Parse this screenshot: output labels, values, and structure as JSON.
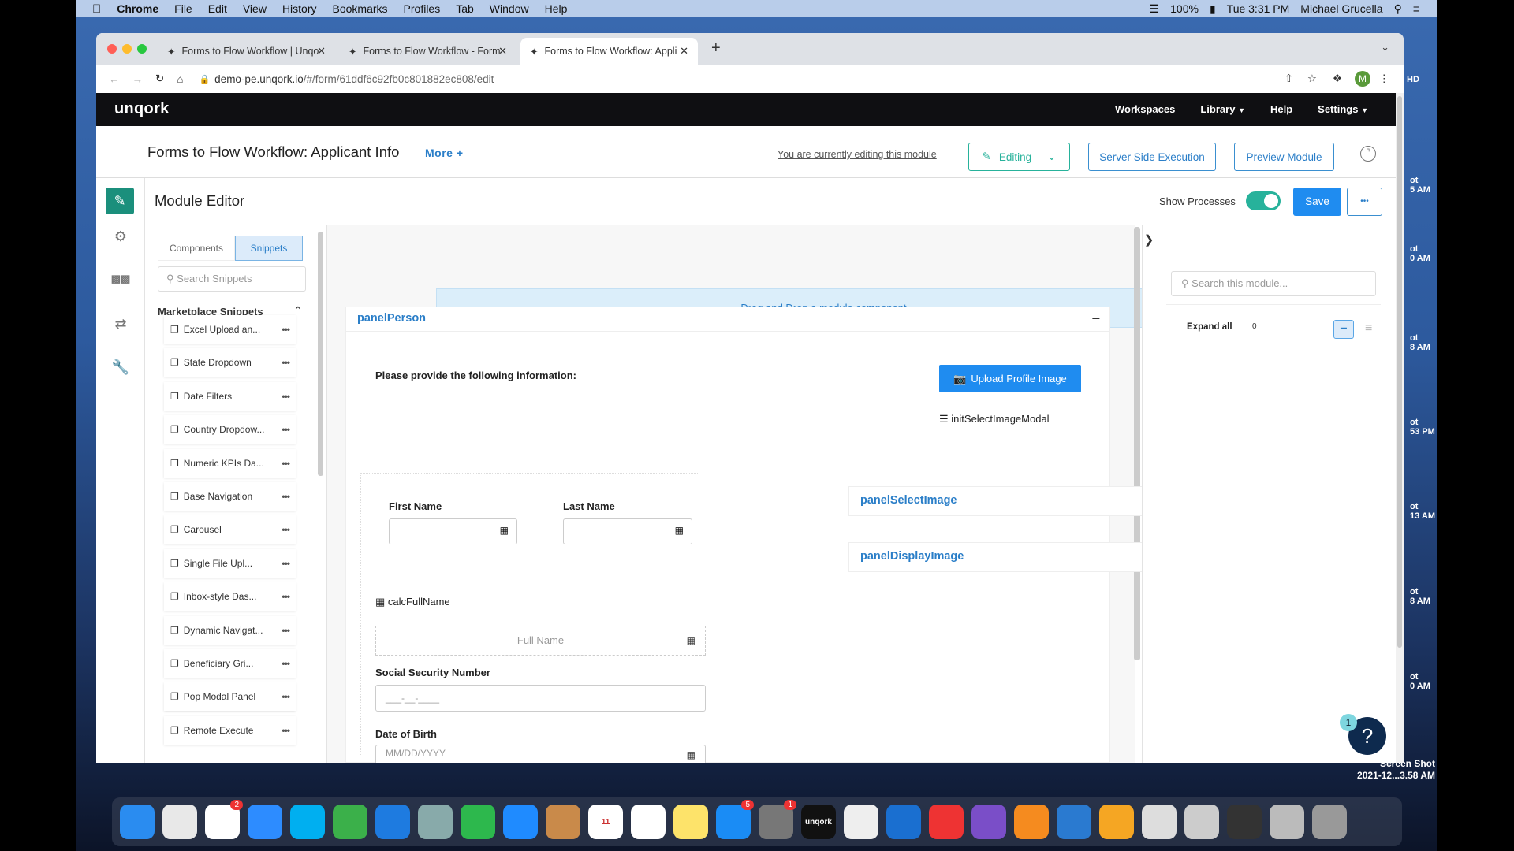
{
  "menubar": {
    "app": "Chrome",
    "items": [
      "File",
      "Edit",
      "View",
      "History",
      "Bookmarks",
      "Profiles",
      "Tab",
      "Window",
      "Help"
    ],
    "battery": "100%",
    "clock": "Tue 3:31 PM",
    "user": "Michael Grucella"
  },
  "browser": {
    "tabs": [
      {
        "label": "Forms to Flow Workflow | Unqo"
      },
      {
        "label": "Forms to Flow Workflow - Form"
      },
      {
        "label": "Forms to Flow Workflow: Appli"
      }
    ],
    "url_host": "demo-pe.unqork.io",
    "url_path": "/#/form/61ddf6c92fb0c801882ec808/edit",
    "profile_initial": "M"
  },
  "app": {
    "logo": "unqork",
    "nav": [
      "Workspaces",
      "Library",
      "Help",
      "Settings"
    ]
  },
  "titlebar": {
    "title": "Forms to Flow Workflow: Applicant Info",
    "more": "More +",
    "editing_notice": "You are currently editing this module",
    "editing": "Editing",
    "server_side": "Server Side Execution",
    "preview": "Preview Module"
  },
  "editor": {
    "title": "Module Editor",
    "show_processes": "Show Processes",
    "show_processes_on": true,
    "save": "Save",
    "more": "•••"
  },
  "snippets": {
    "tabs": [
      "Components",
      "Snippets"
    ],
    "active_tab": "Snippets",
    "search_placeholder": "Search Snippets",
    "section": "Marketplace Snippets",
    "items": [
      "Excel Upload an...",
      "State Dropdown",
      "Date Filters",
      "Country Dropdow...",
      "Numeric KPIs Da...",
      "Base Navigation",
      "Carousel",
      "Single File Upl...",
      "Inbox-style Das...",
      "Dynamic Navigat...",
      "Beneficiary Gri...",
      "Pop Modal Panel",
      "Remote Execute"
    ]
  },
  "canvas": {
    "dropzone": "Drag and Drop a module component",
    "panel": "panelPerson",
    "intro": "Please provide the following information:",
    "upload": "Upload Profile Image",
    "init_modal": "initSelectImageModal",
    "first_name": "First Name",
    "last_name": "Last Name",
    "panel_select": "panelSelectImage",
    "panel_display": "panelDisplayImage",
    "calc": "calcFullName",
    "full_name_placeholder": "Full Name",
    "ssn": "Social Security Number",
    "ssn_mask": "___-__-____",
    "dob": "Date of Birth",
    "dob_placeholder": "MM/DD/YYYY"
  },
  "rightpanel": {
    "search_placeholder": "Search this module...",
    "expand_all": "Expand all",
    "count": "0"
  },
  "help": {
    "badge": "1",
    "label": "?"
  },
  "desktop": {
    "labels": [
      "HD",
      "ot\n5 AM",
      "ot\n0 AM",
      "ot\n8 AM",
      "ot\n53 PM",
      "ot\n13 AM",
      "ot\n8 AM",
      "ot\n0 AM"
    ],
    "screenshot_title": "Screen Shot",
    "screenshot_date": "2021-12...3.58 AM"
  },
  "dock": [
    {
      "name": "finder",
      "color": "#2a8cf0"
    },
    {
      "name": "chrome",
      "color": "#e8e8e8"
    },
    {
      "name": "slack",
      "color": "#fff",
      "badge": "2"
    },
    {
      "name": "zoom",
      "color": "#2d8cff"
    },
    {
      "name": "skype",
      "color": "#00aff0"
    },
    {
      "name": "safari-alt",
      "color": "#3bb04a"
    },
    {
      "name": "safari",
      "color": "#1e7be0"
    },
    {
      "name": "preview",
      "color": "#8aa"
    },
    {
      "name": "facetime",
      "color": "#2db84d"
    },
    {
      "name": "messages",
      "color": "#1f8bff"
    },
    {
      "name": "notebook",
      "color": "#c98a4a"
    },
    {
      "name": "calendar",
      "color": "#fff",
      "text": "11"
    },
    {
      "name": "reminders",
      "color": "#fff"
    },
    {
      "name": "notes",
      "color": "#fde36a"
    },
    {
      "name": "app-store",
      "color": "#1a8cf5",
      "badge": "5"
    },
    {
      "name": "system-preferences",
      "color": "#777",
      "badge": "1"
    },
    {
      "name": "unqork",
      "color": "#111",
      "text": "unqork"
    },
    {
      "name": "textedit",
      "color": "#eee"
    },
    {
      "name": "1password",
      "color": "#1a6fd0"
    },
    {
      "name": "creative-cloud",
      "color": "#e33"
    },
    {
      "name": "visual-studio",
      "color": "#7a4ec8"
    },
    {
      "name": "sketch",
      "color": "#f58b1f"
    },
    {
      "name": "keynote",
      "color": "#2a7ad0"
    },
    {
      "name": "pages",
      "color": "#f5a623"
    },
    {
      "name": "document",
      "color": "#ddd"
    },
    {
      "name": "screenshot",
      "color": "#ccc"
    },
    {
      "name": "terminal",
      "color": "#333"
    },
    {
      "name": "window",
      "color": "#bbb"
    },
    {
      "name": "trash",
      "color": "#999"
    }
  ],
  "colors": {
    "primary": "#1f8cf0",
    "teal": "#27b29b",
    "header": "#0f0f12",
    "link": "#2a7ec8"
  }
}
